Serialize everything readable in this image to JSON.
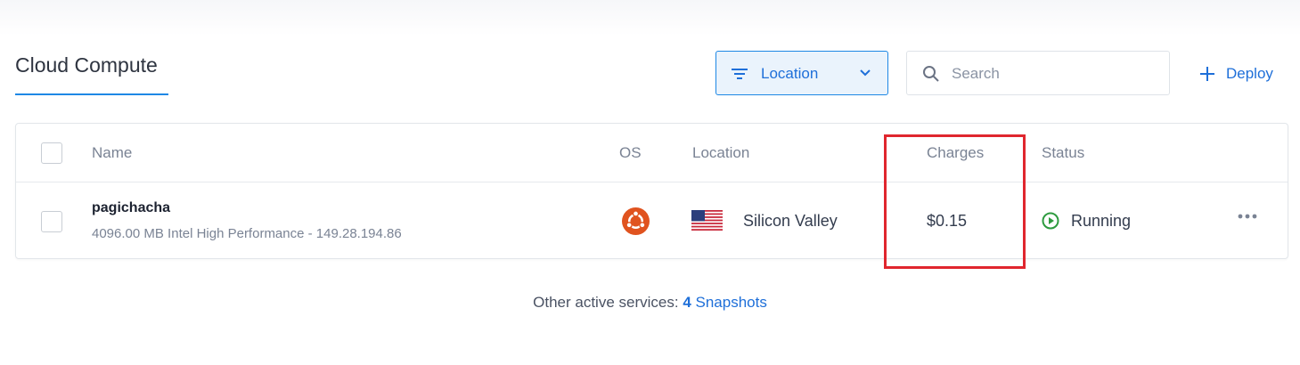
{
  "header": {
    "title": "Cloud Compute",
    "location_filter_label": "Location",
    "search_placeholder": "Search",
    "deploy_label": "Deploy"
  },
  "table": {
    "columns": [
      "Name",
      "OS",
      "Location",
      "Charges",
      "Status"
    ],
    "rows": [
      {
        "name": "pagichacha",
        "meta": "4096.00 MB Intel High Performance - 149.28.194.86",
        "os": "ubuntu-logo-icon",
        "location": "Silicon Valley",
        "flag": "us-flag-icon",
        "charges": "$0.15",
        "status": "Running"
      }
    ]
  },
  "footer": {
    "prefix": "Other active services:",
    "count": "4",
    "link_label": "Snapshots"
  },
  "colors": {
    "accent": "#1e88e5",
    "link": "#1e6fd9",
    "running": "#2e9b3f",
    "ubuntu": "#e0531f",
    "highlight": "#e0262e"
  }
}
